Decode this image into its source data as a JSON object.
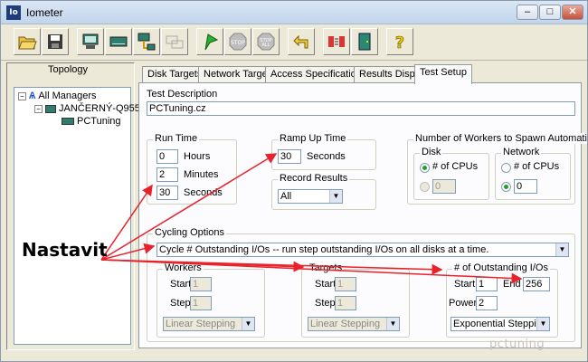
{
  "window": {
    "title": "Iometer",
    "icon_label": "Io"
  },
  "topology": {
    "header": "Topology",
    "items": [
      {
        "label": "All Managers"
      },
      {
        "label": "JANČERNÝ-Q955"
      },
      {
        "label": "PCTuning"
      }
    ]
  },
  "tabs": [
    "Disk Targets",
    "Network Targets",
    "Access Specifications",
    "Results Display",
    "Test Setup"
  ],
  "active_tab": "Test Setup",
  "test_setup": {
    "description_label": "Test Description",
    "description_value": "PCTuning.cz",
    "run_time": {
      "legend": "Run Time",
      "hours_value": "0",
      "hours_label": "Hours",
      "minutes_value": "2",
      "minutes_label": "Minutes",
      "seconds_value": "30",
      "seconds_label": "Seconds"
    },
    "ramp_up": {
      "legend": "Ramp Up Time",
      "value": "30",
      "unit": "Seconds"
    },
    "record_results": {
      "legend": "Record Results",
      "value": "All"
    },
    "workers_spawn": {
      "legend": "Number of Workers to Spawn Automatically",
      "disk": {
        "legend": "Disk",
        "option_cpus": "# of CPUs",
        "value": "0"
      },
      "network": {
        "legend": "Network",
        "option_cpus": "# of CPUs",
        "value": "0"
      }
    },
    "cycling": {
      "legend": "Cycling Options",
      "value": "Cycle # Outstanding I/Os -- run step outstanding I/Os on all disks at a time.",
      "workers": {
        "legend": "Workers",
        "start_label": "Start",
        "start_value": "1",
        "step_label": "Step",
        "step_value": "1",
        "mode": "Linear Stepping"
      },
      "targets": {
        "legend": "Targets",
        "start_label": "Start",
        "start_value": "1",
        "step_label": "Step",
        "step_value": "1",
        "mode": "Linear Stepping"
      },
      "outstanding": {
        "legend": "# of Outstanding I/Os",
        "start_label": "Start",
        "start_value": "1",
        "end_label": "End",
        "end_value": "256",
        "power_label": "Power",
        "power_value": "2",
        "mode": "Exponential Stepping"
      }
    }
  },
  "annotation": {
    "text": "Nastavit",
    "arrow_color": "#e8222a"
  },
  "watermark": "pctuning"
}
